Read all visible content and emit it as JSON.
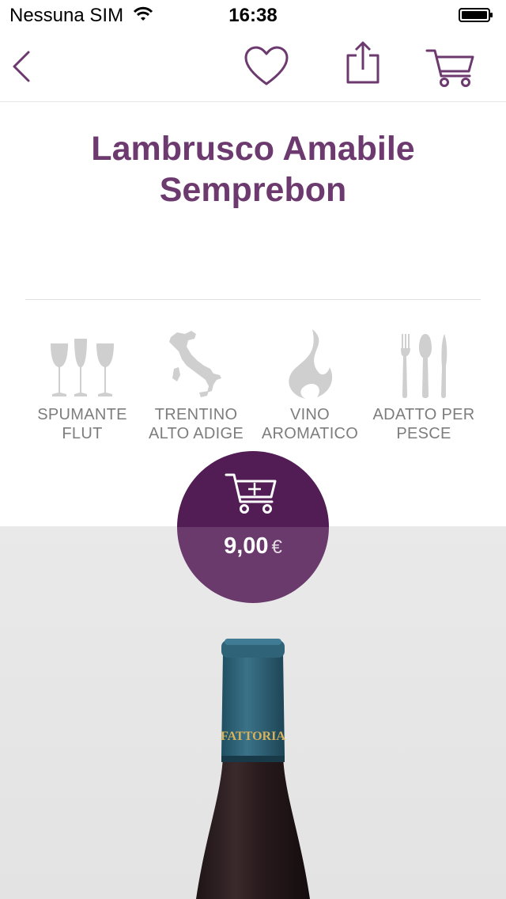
{
  "status_bar": {
    "carrier": "Nessuna SIM",
    "time": "16:38"
  },
  "nav": {
    "icons": [
      "chevron-left-icon",
      "heart-icon",
      "share-icon",
      "cart-icon"
    ]
  },
  "product": {
    "name_line1": "Lambrusco Amabile",
    "name_line2": "Semprebon",
    "bottle_label": "FATTORIA"
  },
  "features": [
    {
      "icon": "wine-glasses-icon",
      "line1": "SPUMANTE",
      "line2": "FLUT"
    },
    {
      "icon": "italy-map-icon",
      "line1": "TRENTINO",
      "line2": "ALTO ADIGE"
    },
    {
      "icon": "aroma-icon",
      "line1": "VINO",
      "line2": "AROMATICO"
    },
    {
      "icon": "cutlery-icon",
      "line1": "ADATTO PER",
      "line2": "PESCE"
    }
  ],
  "price": {
    "amount": "9,00",
    "currency": "€"
  },
  "colors": {
    "accent": "#6d3a6f",
    "circle_top": "#521c55",
    "circle_bottom": "#6b3a6d",
    "feature_text": "#7d7d7d",
    "background_gray": "#e6e6e6"
  }
}
